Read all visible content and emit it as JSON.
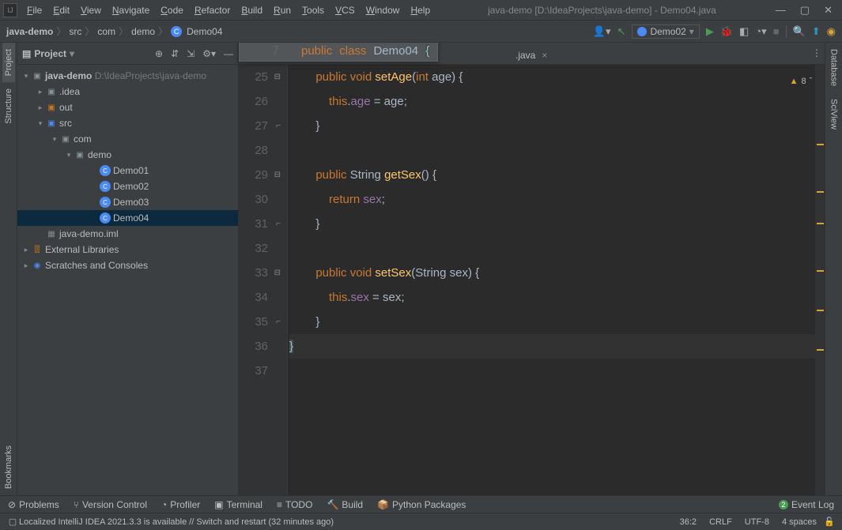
{
  "titlebar": {
    "menus": [
      "File",
      "Edit",
      "View",
      "Navigate",
      "Code",
      "Refactor",
      "Build",
      "Run",
      "Tools",
      "VCS",
      "Window",
      "Help"
    ],
    "title": "java-demo [D:\\IdeaProjects\\java-demo] - Demo04.java"
  },
  "breadcrumb": {
    "items": [
      "java-demo",
      "src",
      "com",
      "demo",
      "Demo04"
    ]
  },
  "run_config": "Demo02",
  "project_panel": {
    "title": "Project"
  },
  "tree": {
    "root_name": "java-demo",
    "root_path": "D:\\IdeaProjects\\java-demo",
    "idea": ".idea",
    "out": "out",
    "src": "src",
    "com": "com",
    "demo": "demo",
    "classes": [
      "Demo01",
      "Demo02",
      "Demo03",
      "Demo04"
    ],
    "iml": "java-demo.iml",
    "ext_libs": "External Libraries",
    "scratch": "Scratches and Consoles"
  },
  "floating_tab": {
    "line": "7",
    "code_html": "<span class='kw'>public</span> <span class='kw'>class</span> <span class='className'>Demo04</span> <span class='punct hl-brace'>{</span>"
  },
  "tab": {
    "name": ".java"
  },
  "warn": {
    "count": "8"
  },
  "code_lines": [
    {
      "n": "25",
      "html": "        <span class='kw'>public</span> <span class='kw'>void</span> <span class='method'>setAge</span><span class='punct'>(</span><span class='kw'>int</span> <span class='param'>age</span><span class='punct'>) {</span>"
    },
    {
      "n": "26",
      "html": "            <span class='this-kw'>this</span><span class='punct'>.</span><span class='field'>age</span> <span class='punct'>=</span> <span class='ident'>age</span><span class='punct'>;</span>"
    },
    {
      "n": "27",
      "html": "        <span class='punct'>}</span>"
    },
    {
      "n": "28",
      "html": ""
    },
    {
      "n": "29",
      "html": "        <span class='kw'>public</span> <span class='type'>String</span> <span class='method'>getSex</span><span class='punct'>() {</span>"
    },
    {
      "n": "30",
      "html": "            <span class='kw'>return</span> <span class='field'>sex</span><span class='punct'>;</span>"
    },
    {
      "n": "31",
      "html": "        <span class='punct'>}</span>"
    },
    {
      "n": "32",
      "html": ""
    },
    {
      "n": "33",
      "html": "        <span class='kw'>public</span> <span class='kw'>void</span> <span class='method'>setSex</span><span class='punct'>(</span><span class='type'>String</span> <span class='param'>sex</span><span class='punct'>) {</span>"
    },
    {
      "n": "34",
      "html": "            <span class='this-kw'>this</span><span class='punct'>.</span><span class='field'>sex</span> <span class='punct'>=</span> <span class='ident'>sex</span><span class='punct'>;</span>"
    },
    {
      "n": "35",
      "html": "        <span class='punct'>}</span>"
    },
    {
      "n": "36",
      "html": "<span class='punct hl-brace'>}</span>",
      "caret": true
    },
    {
      "n": "37",
      "html": ""
    }
  ],
  "left_tabs": [
    "Project",
    "Structure",
    "Bookmarks"
  ],
  "right_tabs": [
    "Database",
    "SciView"
  ],
  "bottom_tabs": [
    "Problems",
    "Version Control",
    "Profiler",
    "Terminal",
    "TODO",
    "Build",
    "Python Packages"
  ],
  "event_log": "Event Log",
  "status": {
    "msg": "Localized IntelliJ IDEA 2021.3.3 is available // Switch and restart (32 minutes ago)",
    "pos": "36:2",
    "eol": "CRLF",
    "enc": "UTF-8",
    "indent": "4 spaces"
  }
}
